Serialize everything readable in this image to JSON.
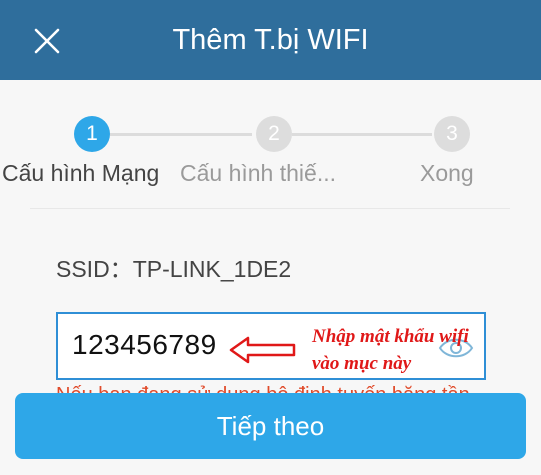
{
  "header": {
    "title": "Thêm T.bị WIFI",
    "close_icon": "close-icon",
    "background": "#2f6e9c"
  },
  "stepper": {
    "steps": [
      {
        "number": "1",
        "label": "Cấu hình Mạng",
        "state": "active"
      },
      {
        "number": "2",
        "label": "Cấu hình thiế...",
        "state": "inactive"
      },
      {
        "number": "3",
        "label": "Xong",
        "state": "inactive"
      }
    ],
    "active_color": "#2ea7e8"
  },
  "ssid": {
    "label": "SSID：",
    "value": "TP-LINK_1DE2"
  },
  "password": {
    "value": "123456789",
    "visibility_icon": "eye-icon"
  },
  "annotation": {
    "line1": "Nhập mật khẩu wifi",
    "line2": "vào mục này",
    "color": "#e01818"
  },
  "warning": {
    "text": "Nếu bạn đang sử dụng bộ định tuyến băng tần"
  },
  "next_button": {
    "label": "Tiếp theo"
  }
}
